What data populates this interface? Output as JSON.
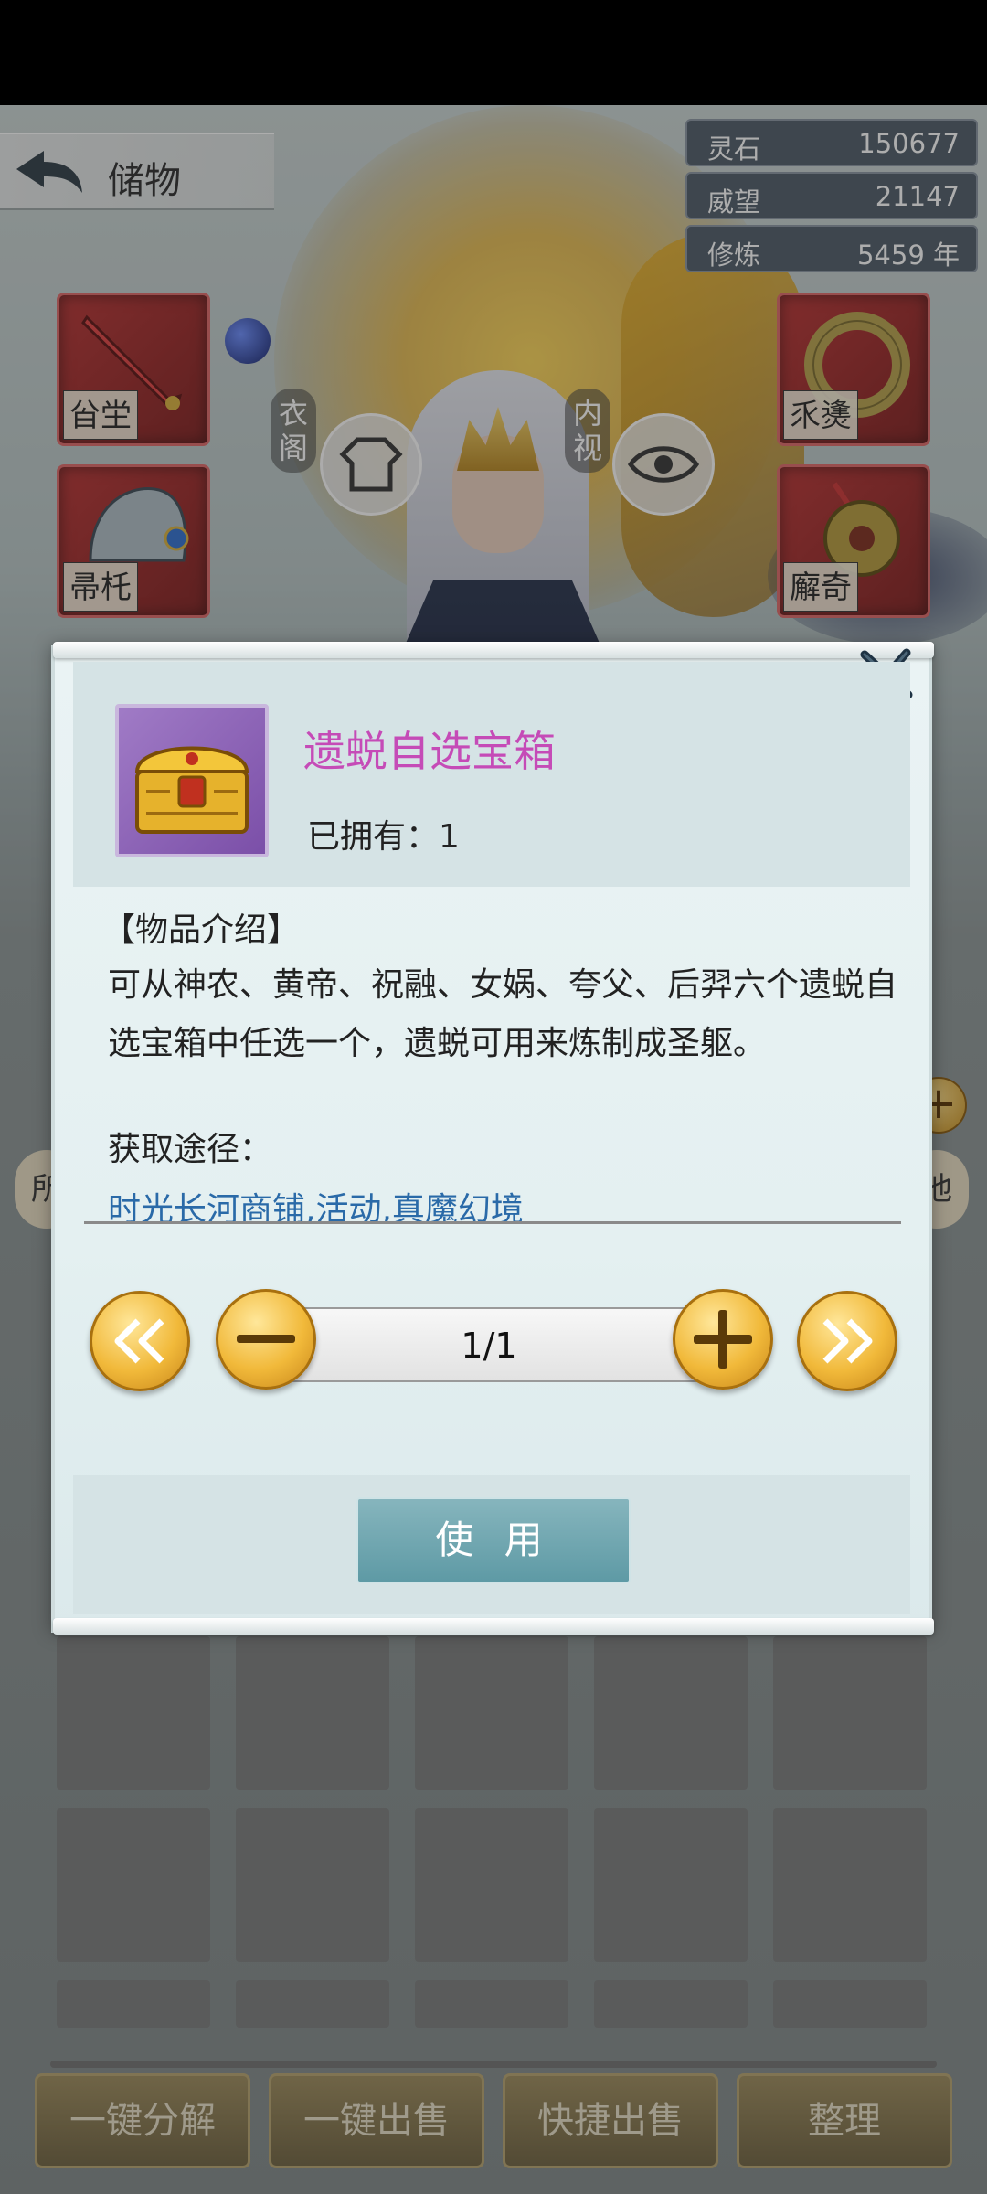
{
  "header": {
    "title": "储物"
  },
  "resources": [
    {
      "label": "灵石",
      "value": "150677"
    },
    {
      "label": "威望",
      "value": "21147"
    },
    {
      "label": "修炼",
      "value": "5459 年"
    }
  ],
  "equipment": {
    "left": [
      {
        "emblem": "㒶坣"
      },
      {
        "emblem": "帚杔"
      }
    ],
    "right": [
      {
        "emblem": "乑㷭"
      },
      {
        "emblem": "廨奇"
      }
    ]
  },
  "character_buttons": {
    "wardrobe": "衣阁",
    "inner_view": "内视"
  },
  "inventory": {
    "tab_left": "所",
    "tab_right": "他"
  },
  "bottom_buttons": [
    "一键分解",
    "一键出售",
    "快捷出售",
    "整理"
  ],
  "item_popup": {
    "name": "遗蜕自选宝箱",
    "owned": "已拥有：1",
    "description_title": "【物品介绍】",
    "description": "可从神农、黄帝、祝融、女娲、夸父、后羿六个遗蜕自选宝箱中任选一个，遗蜕可用来炼制成圣躯。",
    "source_title": "获取途径：",
    "source": "时光长河商铺,活动,真魔幻境",
    "quantity": "1/1",
    "use_label": "使 用"
  },
  "colors": {
    "item_name": "#c54bb7",
    "source_link": "#2a6aa8",
    "gold_button": "#f1b93a"
  },
  "icons": [
    "back-arrow-icon",
    "close-icon",
    "robe-icon",
    "eye-icon",
    "treasure-chest-icon",
    "double-left-icon",
    "minus-icon",
    "plus-icon",
    "double-right-icon"
  ]
}
